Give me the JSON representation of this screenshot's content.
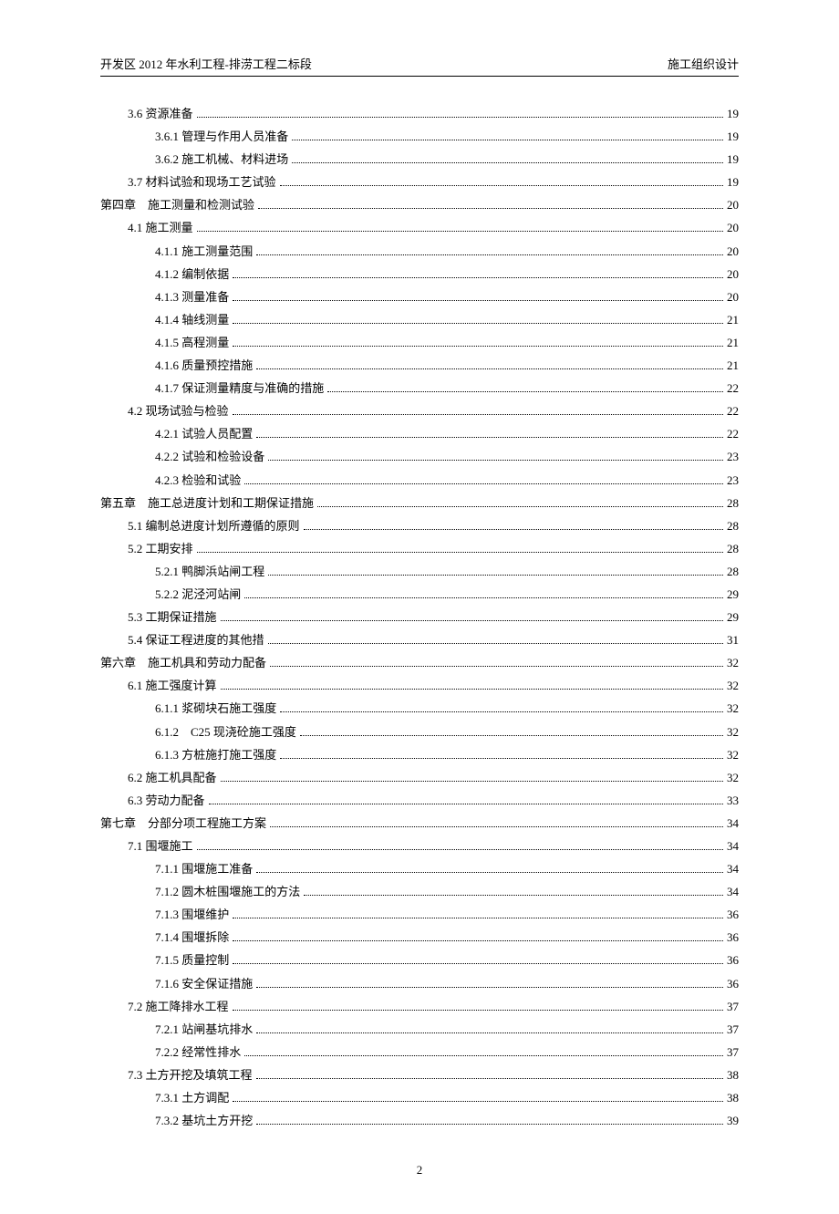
{
  "header": {
    "left": "开发区 2012 年水利工程-排涝工程二标段",
    "right": "施工组织设计"
  },
  "toc": [
    {
      "indent": 1,
      "text": "3.6 资源准备",
      "page": "19"
    },
    {
      "indent": 2,
      "text": "3.6.1 管理与作用人员准备",
      "page": "19"
    },
    {
      "indent": 2,
      "text": "3.6.2 施工机械、材料进场",
      "page": "19"
    },
    {
      "indent": 1,
      "text": "3.7 材料试验和现场工艺试验",
      "page": "19"
    },
    {
      "indent": 0,
      "text": "第四章　施工测量和检测试验",
      "page": "20"
    },
    {
      "indent": 1,
      "text": "4.1 施工测量",
      "page": "20"
    },
    {
      "indent": 2,
      "text": "4.1.1 施工测量范围",
      "page": "20"
    },
    {
      "indent": 2,
      "text": "4.1.2 编制依据",
      "page": "20"
    },
    {
      "indent": 2,
      "text": "4.1.3 测量准备",
      "page": "20"
    },
    {
      "indent": 2,
      "text": "4.1.4 轴线测量",
      "page": "21"
    },
    {
      "indent": 2,
      "text": "4.1.5 高程测量",
      "page": "21"
    },
    {
      "indent": 2,
      "text": "4.1.6 质量预控措施",
      "page": "21"
    },
    {
      "indent": 2,
      "text": "4.1.7 保证测量精度与准确的措施",
      "page": "22"
    },
    {
      "indent": 1,
      "text": "4.2 现场试验与检验",
      "page": "22"
    },
    {
      "indent": 2,
      "text": "4.2.1 试验人员配置",
      "page": "22"
    },
    {
      "indent": 2,
      "text": "4.2.2 试验和检验设备",
      "page": "23"
    },
    {
      "indent": 2,
      "text": "4.2.3 检验和试验",
      "page": "23"
    },
    {
      "indent": 0,
      "text": "第五章　施工总进度计划和工期保证措施",
      "page": "28"
    },
    {
      "indent": 1,
      "text": "5.1 编制总进度计划所遵循的原则",
      "page": "28"
    },
    {
      "indent": 1,
      "text": "5.2 工期安排",
      "page": "28"
    },
    {
      "indent": 2,
      "text": "5.2.1 鸭脚浜站闸工程",
      "page": "28"
    },
    {
      "indent": 2,
      "text": "5.2.2 泥泾河站闸",
      "page": "29"
    },
    {
      "indent": 1,
      "text": "5.3 工期保证措施",
      "page": "29"
    },
    {
      "indent": 1,
      "text": "5.4 保证工程进度的其他措",
      "page": "31"
    },
    {
      "indent": 0,
      "text": "第六章　施工机具和劳动力配备",
      "page": "32"
    },
    {
      "indent": 1,
      "text": "6.1 施工强度计算",
      "page": "32"
    },
    {
      "indent": 2,
      "text": "6.1.1 浆砌块石施工强度",
      "page": "32"
    },
    {
      "indent": 2,
      "text": "6.1.2　C25 现浇砼施工强度",
      "page": "32"
    },
    {
      "indent": 2,
      "text": "6.1.3 方桩施打施工强度",
      "page": "32"
    },
    {
      "indent": 1,
      "text": "6.2 施工机具配备",
      "page": "32"
    },
    {
      "indent": 1,
      "text": "6.3 劳动力配备",
      "page": "33"
    },
    {
      "indent": 0,
      "text": "第七章　分部分项工程施工方案",
      "page": "34"
    },
    {
      "indent": 1,
      "text": "7.1 围堰施工",
      "page": "34"
    },
    {
      "indent": 2,
      "text": "7.1.1 围堰施工准备",
      "page": "34"
    },
    {
      "indent": 2,
      "text": "7.1.2 圆木桩围堰施工的方法",
      "page": "34"
    },
    {
      "indent": 2,
      "text": "7.1.3 围堰维护",
      "page": "36"
    },
    {
      "indent": 2,
      "text": "7.1.4 围堰拆除",
      "page": "36"
    },
    {
      "indent": 2,
      "text": "7.1.5 质量控制",
      "page": "36"
    },
    {
      "indent": 2,
      "text": "7.1.6 安全保证措施",
      "page": "36"
    },
    {
      "indent": 1,
      "text": "7.2 施工降排水工程",
      "page": "37"
    },
    {
      "indent": 2,
      "text": "7.2.1 站闸基坑排水",
      "page": "37"
    },
    {
      "indent": 2,
      "text": "7.2.2 经常性排水",
      "page": "37"
    },
    {
      "indent": 1,
      "text": "7.3 土方开挖及填筑工程",
      "page": "38"
    },
    {
      "indent": 2,
      "text": "7.3.1 土方调配",
      "page": "38"
    },
    {
      "indent": 2,
      "text": "7.3.2 基坑土方开挖",
      "page": "39"
    }
  ],
  "pageNumber": "2"
}
